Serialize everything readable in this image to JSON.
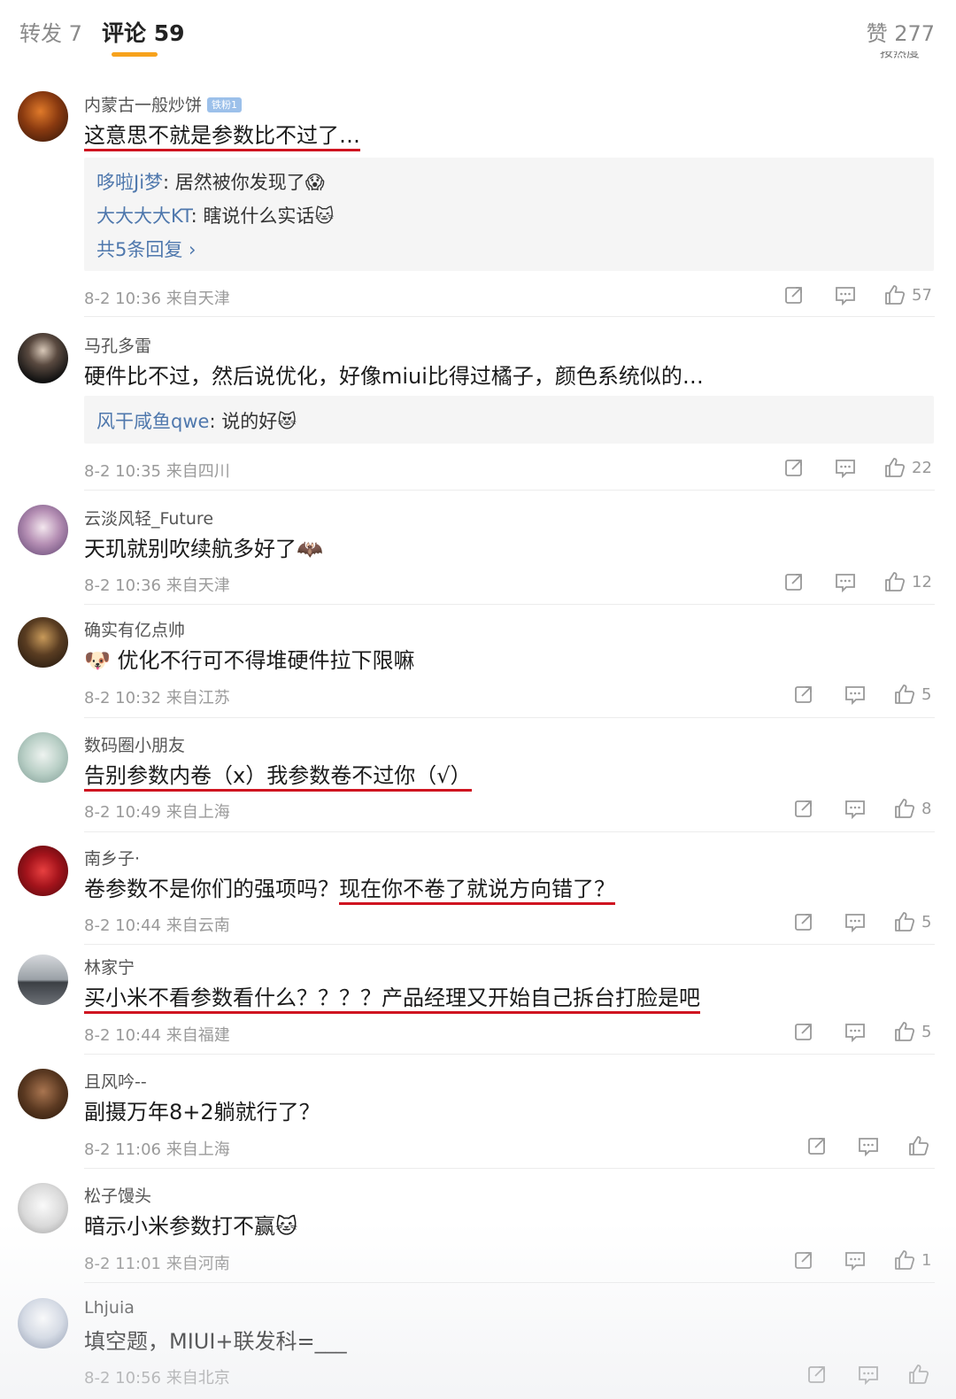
{
  "tabs": {
    "reposts": "转发 7",
    "comments": "评论 59",
    "likes": "赞 277",
    "sort_peek": "按热度"
  },
  "comments": [
    {
      "username": "内蒙古一般炒饼",
      "badge": "铁粉1",
      "text": "这意思不就是参数比不过了…",
      "replies": [
        {
          "author": "哆啦Ji梦",
          "sep": ": ",
          "text": "居然被你发现了",
          "emoji": "😱"
        },
        {
          "author": "大大大大KT",
          "sep": ": ",
          "text": "瞎说什么实话",
          "emoji": "🐱"
        }
      ],
      "more_replies": "共5条回复 ›",
      "meta": "8-2 10:36 来自天津",
      "likes": "57"
    },
    {
      "username": "马孔多雷",
      "text": "硬件比不过，然后说优化，好像miui比得过橘子，颜色系统似的…",
      "replies": [
        {
          "author": "风干咸鱼qwe",
          "sep": ": ",
          "text": "说的好",
          "emoji": "😻"
        }
      ],
      "meta": "8-2 10:35 来自四川",
      "likes": "22"
    },
    {
      "username": "云淡风轻_Future",
      "text": "天玑就别吹续航多好了",
      "emoji": "🦇",
      "meta": "8-2 10:36 来自天津",
      "likes": "12"
    },
    {
      "username": "确实有亿点帅",
      "emoji_prefix": "🐶",
      "text": "优化不行可不得堆硬件拉下限嘛",
      "meta": "8-2 10:32 来自江苏",
      "likes": "5"
    },
    {
      "username": "数码圈小朋友",
      "text": "告别参数内卷（x）我参数卷不过你（√）",
      "meta": "8-2 10:49 来自上海",
      "likes": "8"
    },
    {
      "username": "南乡子·",
      "text_a": "卷参数不是你们的强项吗？",
      "text_b": "现在你不卷了就说方向错了？",
      "meta": "8-2 10:44 来自云南",
      "likes": "5"
    },
    {
      "username": "林家宁",
      "text": "买小米不看参数看什么？？？？产品经理又开始自己拆台打脸是吧",
      "meta": "8-2 10:44 来自福建",
      "likes": "5"
    },
    {
      "username": "且风吟--",
      "text": "副摄万年8+2躺就行了？",
      "meta": "8-2 11:06 来自上海",
      "likes": ""
    },
    {
      "username": "松子馒头",
      "text": "暗示小米参数打不赢",
      "emoji": "🐱",
      "meta": "8-2 11:01 来自河南",
      "likes": "1"
    },
    {
      "username": "Lhjuia",
      "text": "填空题，MIUI+联发科=___",
      "meta": "8-2 10:56 来自北京",
      "likes": ""
    }
  ],
  "colors": {
    "accent_tab": "#f7a21c",
    "underline": "#cf1420",
    "reply_author": "#4f78ad"
  }
}
